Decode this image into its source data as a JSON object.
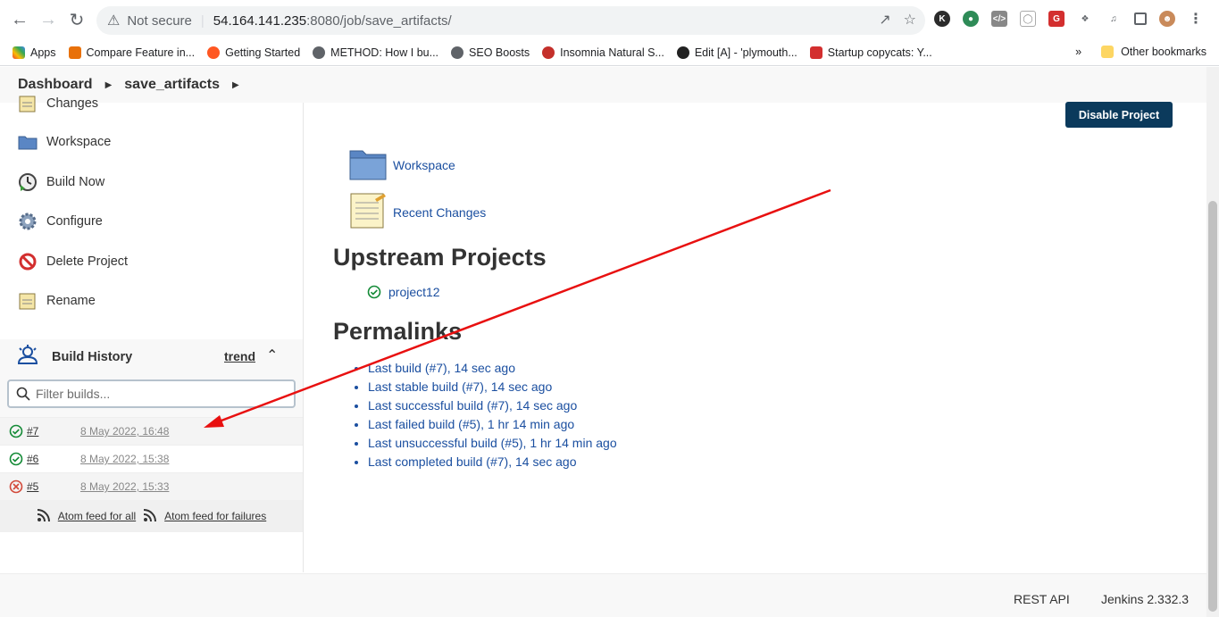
{
  "browser": {
    "security_label": "Not secure",
    "url_host": "54.164.141.235",
    "url_port_path": ":8080/job/save_artifacts/",
    "bookmarks": [
      {
        "label": "Apps",
        "color": "#4285f4"
      },
      {
        "label": "Compare Feature in...",
        "color": "#e8710a"
      },
      {
        "label": "Getting Started",
        "color": "#ff5722"
      },
      {
        "label": "METHOD: How I bu...",
        "color": "#5f6368"
      },
      {
        "label": "SEO Boosts",
        "color": "#5f6368"
      },
      {
        "label": "Insomnia Natural S...",
        "color": "#c4302b"
      },
      {
        "label": "Edit [A] - 'plymouth...",
        "color": "#222222"
      },
      {
        "label": "Startup copycats: Y...",
        "color": "#d32f2f"
      }
    ],
    "more_bookmarks": "»",
    "other_bookmarks": "Other bookmarks"
  },
  "breadcrumb": {
    "dashboard": "Dashboard",
    "job": "save_artifacts"
  },
  "sidebar": {
    "tasks": [
      {
        "label": "Changes",
        "icon": "notepad-icon"
      },
      {
        "label": "Workspace",
        "icon": "folder-icon"
      },
      {
        "label": "Build Now",
        "icon": "clock-icon"
      },
      {
        "label": "Configure",
        "icon": "gear-icon"
      },
      {
        "label": "Delete Project",
        "icon": "no-entry-icon"
      },
      {
        "label": "Rename",
        "icon": "notepad-icon"
      }
    ]
  },
  "build_history": {
    "title": "Build History",
    "trend": "trend",
    "filter_placeholder": "Filter builds...",
    "builds": [
      {
        "num": "#7",
        "date": "8 May 2022, 16:48",
        "status": "success"
      },
      {
        "num": "#6",
        "date": "8 May 2022, 15:38",
        "status": "success"
      },
      {
        "num": "#5",
        "date": "8 May 2022, 15:33",
        "status": "failed"
      }
    ],
    "feed_all": "Atom feed for all",
    "feed_failures": "Atom feed for failures"
  },
  "main": {
    "disable_button": "Disable Project",
    "workspace_link": "Workspace",
    "recent_changes_link": "Recent Changes",
    "upstream_title": "Upstream Projects",
    "upstream_project": "project12",
    "permalinks_title": "Permalinks",
    "permalinks": [
      "Last build (#7), 14 sec ago",
      "Last stable build (#7), 14 sec ago",
      "Last successful build (#7), 14 sec ago",
      "Last failed build (#5), 1 hr 14 min ago",
      "Last unsuccessful build (#5), 1 hr 14 min ago",
      "Last completed build (#7), 14 sec ago"
    ]
  },
  "footer": {
    "rest_api": "REST API",
    "version": "Jenkins 2.332.3"
  },
  "colors": {
    "accent": "#0b3a5c",
    "link": "#1b4fa0",
    "success": "#138a36",
    "failure": "#d24939",
    "annotation_arrow": "#e81010"
  }
}
